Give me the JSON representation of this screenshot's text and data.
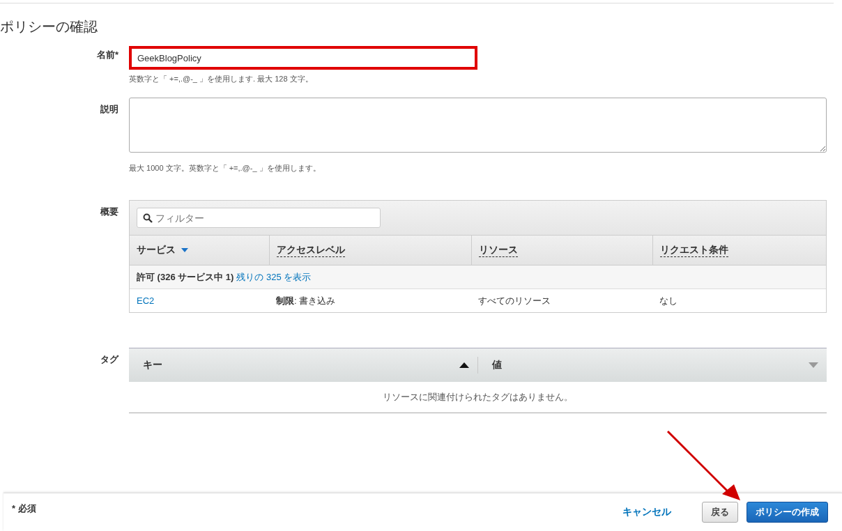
{
  "heading": "ポリシーの確認",
  "name_field": {
    "label": "名前*",
    "value": "GeekBlogPolicy",
    "hint": "英数字と「 +=,.@-_ 」を使用します. 最大 128 文字。",
    "highlighted": true
  },
  "description_field": {
    "label": "説明",
    "hint": "最大 1000 文字。英数字と「 +=,.@-_ 」を使用します。"
  },
  "summary": {
    "label": "概要",
    "filter": {
      "placeholder": "フィルター"
    },
    "columns": [
      {
        "label": "サービス",
        "sorted": true
      },
      {
        "label": "アクセスレベル",
        "sorted": false
      },
      {
        "label": "リソース",
        "sorted": false
      },
      {
        "label": "リクエスト条件",
        "sorted": false
      }
    ],
    "group": {
      "label": "許可 (326 サービス中 1)",
      "link": "残りの 325 を表示"
    },
    "rows": [
      [
        "EC2",
        "**制限**: 書き込み",
        "すべてのリソース",
        "なし"
      ]
    ]
  },
  "tags": {
    "label": "タグ",
    "columns": [
      "キー",
      "値"
    ],
    "empty": "リソースに関連付けられたタグはありません。"
  },
  "footer": {
    "required": "* 必須",
    "cancel": "キャンセル",
    "back": "戻る",
    "create": "ポリシーの作成"
  }
}
